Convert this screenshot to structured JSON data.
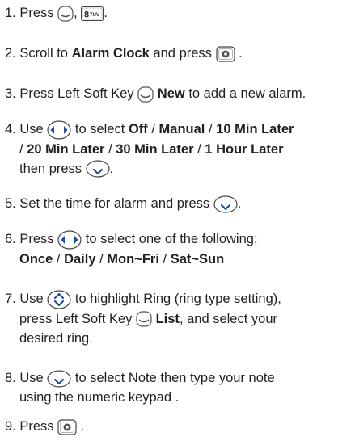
{
  "steps": [
    {
      "num": "1.",
      "press": "Press",
      "comma": ",",
      "period": ".",
      "key_icons": [
        "left-soft-key-icon",
        "key-8-tuv-icon"
      ],
      "key_8_label": "8",
      "key_8_letters": "TUV"
    },
    {
      "num": "2.",
      "t1": "Scroll to",
      "b1": "Alarm Clock",
      "t2": "and press",
      "period": ".",
      "key_icons": [
        "ok-key-icon"
      ]
    },
    {
      "num": "3.",
      "t1": "Press Left Soft Key",
      "b1": "New",
      "t2": "to add a new alarm.",
      "key_icons": [
        "left-soft-key-icon"
      ]
    },
    {
      "num": "4.",
      "t1": "Use",
      "t2": "to select",
      "options_line1": [
        "Off",
        "Manual",
        "10 Min Later"
      ],
      "options_line2": [
        "20 Min Later",
        "30 Min Later",
        "1 Hour Later"
      ],
      "sep": "/",
      "t3": "then press",
      "period": ".",
      "key_icons": [
        "left-right-nav-key-icon",
        "down-nav-key-icon"
      ]
    },
    {
      "num": "5.",
      "t1": "Set the time for alarm and press",
      "period": ".",
      "key_icons": [
        "down-nav-key-icon"
      ]
    },
    {
      "num": "6.",
      "t1": "Press",
      "t2": "to select one of the following:",
      "options": [
        "Once",
        "Daily",
        "Mon~Fri",
        "Sat~Sun"
      ],
      "sep": "/",
      "key_icons": [
        "left-right-nav-key-icon"
      ]
    },
    {
      "num": "7.",
      "t1": "Use",
      "t2": "to highlight Ring (ring type setting),",
      "t3": "press Left Soft Key",
      "b1": "List",
      "t4": ", and select your",
      "t5": "desired ring.",
      "key_icons": [
        "up-down-nav-key-icon",
        "left-soft-key-icon"
      ]
    },
    {
      "num": "8.",
      "t1": "Use",
      "t2": "to select Note then type your note",
      "t3": "using the numeric keypad .",
      "key_icons": [
        "down-nav-key-icon"
      ]
    },
    {
      "num": "9.",
      "t1": "Press",
      "period": ".",
      "key_icons": [
        "ok-key-icon"
      ]
    }
  ]
}
